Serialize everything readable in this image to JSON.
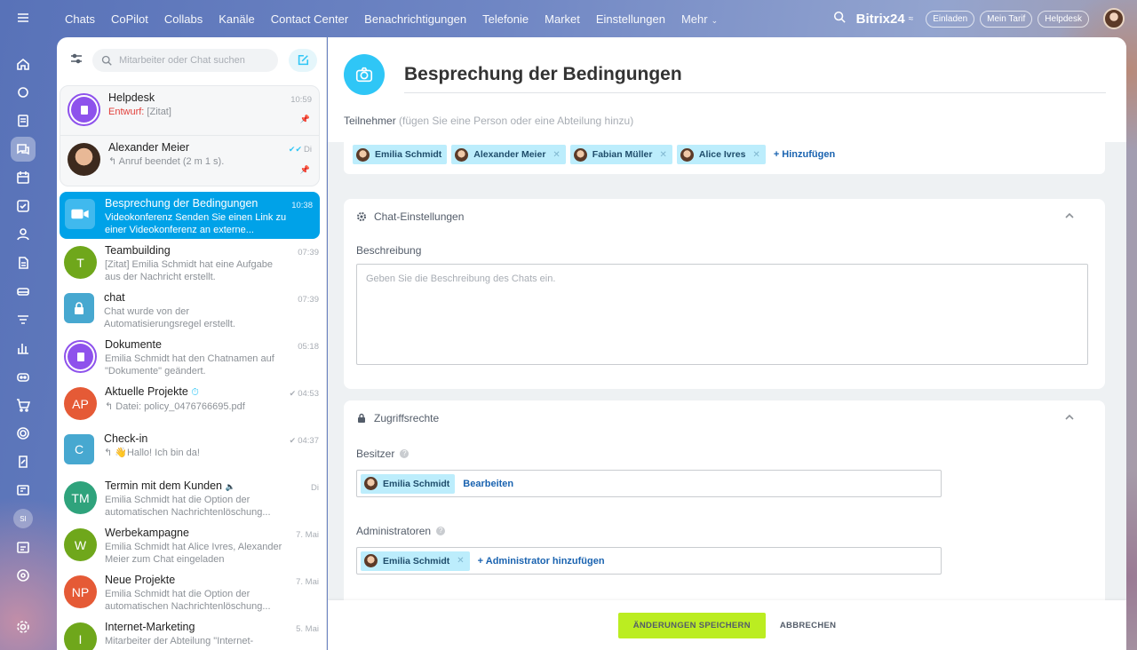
{
  "nav": {
    "items": [
      "Chats",
      "CoPilot",
      "Collabs",
      "Kanäle",
      "Contact Center",
      "Benachrichtigungen",
      "Telefonie",
      "Market",
      "Einstellungen",
      "Mehr"
    ],
    "brand": "Bitrix24",
    "invite": "Einladen",
    "tariff": "Mein Tarif",
    "helpdesk": "Helpdesk"
  },
  "rail": {
    "si": "SI"
  },
  "chatlist": {
    "search_placeholder": "Mitarbeiter oder Chat suchen",
    "pinned": [
      {
        "name": "Helpdesk",
        "draft": "Entwurf:",
        "msg": " [Zitat]",
        "time": "10:59",
        "avatar": "purple"
      },
      {
        "name": "Alexander Meier",
        "msg": "↰ Anruf beendet (2 m 1 s).",
        "time": "Di",
        "avatar": "photo"
      }
    ],
    "active": {
      "name": "Besprechung der Bedingungen",
      "msg": "Videokonferenz Senden Sie einen Link zu einer Videokonferenz an externe...",
      "time": "10:38"
    },
    "items": [
      {
        "name": "Teambuilding",
        "msg": "[Zitat] Emilia Schmidt hat eine Aufgabe aus der Nachricht erstellt.",
        "time": "07:39",
        "initials": "T",
        "color": "#6fa71b"
      },
      {
        "name": "chat",
        "msg": "Chat wurde von der Automatisierungsregel erstellt.",
        "time": "07:39",
        "initials": "",
        "color": "#47a8d0"
      },
      {
        "name": "Dokumente",
        "msg": "Emilia Schmidt hat den Chatnamen auf \"Dokumente\" geändert.",
        "time": "05:18",
        "initials": "",
        "color": "purple"
      },
      {
        "name": "Aktuelle Projekte",
        "msg": "↰ Datei: policy_0476766695.pdf",
        "time": "04:53",
        "initials": "AP",
        "color": "#e55a36"
      },
      {
        "name": "Check-in",
        "msg": "↰ 👋Hallo! Ich bin da!",
        "time": "04:37",
        "initials": "C",
        "color": "#47a8d0"
      },
      {
        "name": "Termin mit dem Kunden",
        "msg": "Emilia Schmidt hat die Option der automatischen Nachrichtenlöschung...",
        "time": "Di",
        "initials": "TM",
        "color": "#2fa37c"
      },
      {
        "name": "Werbekampagne",
        "msg": "Emilia Schmidt hat Alice Ivres, Alexander Meier zum Chat eingeladen",
        "time": "7. Mai",
        "initials": "W",
        "color": "#6fa71b"
      },
      {
        "name": "Neue Projekte",
        "msg": "Emilia Schmidt hat die Option der automatischen Nachrichtenlöschung...",
        "time": "7. Mai",
        "initials": "NP",
        "color": "#e55a36"
      },
      {
        "name": "Internet-Marketing",
        "msg": "Mitarbeiter der Abteilung \"Internet-",
        "time": "5. Mai",
        "initials": "I",
        "color": "#6fa71b"
      }
    ]
  },
  "panel": {
    "title": "Besprechung der Bedingungen",
    "participants_label": "Teilnehmer",
    "participants_hint": "(fügen Sie eine Person oder eine Abteilung hinzu)",
    "participants": [
      "Emilia Schmidt",
      "Alexander Meier",
      "Fabian Müller",
      "Alice Ivres"
    ],
    "add": "+ Hinzufügen",
    "chat_settings": "Chat-Einstellungen",
    "description_label": "Beschreibung",
    "description_placeholder": "Geben Sie die Beschreibung des Chats ein.",
    "access": "Zugriffsrechte",
    "owner_label": "Besitzer",
    "owner": "Emilia Schmidt",
    "edit": "Bearbeiten",
    "admins_label": "Administratoren",
    "admin": "Emilia Schmidt",
    "add_admin": "+ Administrator hinzufügen",
    "save": "ÄNDERUNGEN SPEICHERN",
    "cancel": "ABBRECHEN"
  }
}
